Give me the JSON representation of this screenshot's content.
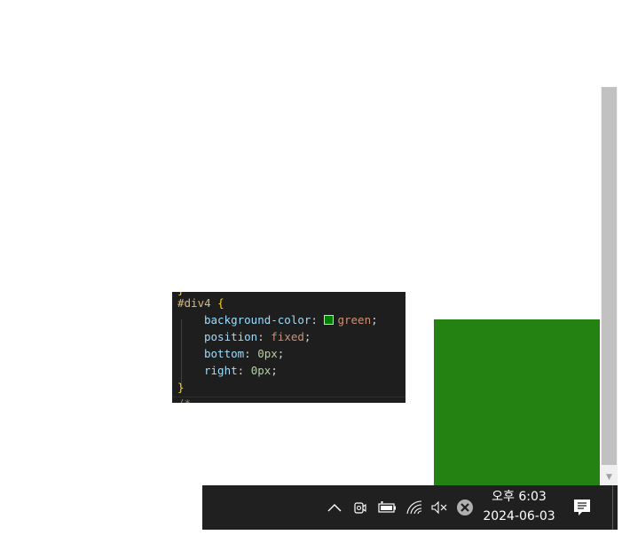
{
  "code_panel": {
    "partial_top": "}",
    "selector": "#div4",
    "open_brace": "{",
    "close_brace": "}",
    "declarations": [
      {
        "property": "background-color",
        "value": "green",
        "swatch": "#008000",
        "value_type": "keyword"
      },
      {
        "property": "position",
        "value": "fixed",
        "value_type": "keyword"
      },
      {
        "property": "bottom",
        "value": "0px",
        "value_type": "number"
      },
      {
        "property": "right",
        "value": "0px",
        "value_type": "number"
      }
    ],
    "partial_bottom": "/*"
  },
  "green_box": {
    "color": "#238212"
  },
  "taskbar": {
    "tray_icons": [
      {
        "name": "show-hidden-icons-chevron-icon",
        "glyph": "^"
      },
      {
        "name": "webcam-icon"
      },
      {
        "name": "battery-icon"
      },
      {
        "name": "wifi-icon"
      },
      {
        "name": "volume-muted-icon"
      },
      {
        "name": "error-close-icon"
      }
    ],
    "clock": {
      "time": "오후 6:03",
      "date": "2024-06-03"
    },
    "notification_icon": "action-center-icon"
  }
}
